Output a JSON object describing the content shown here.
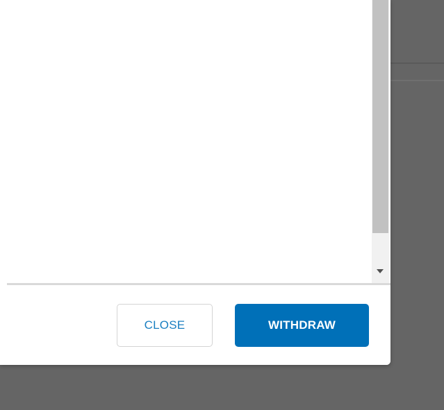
{
  "dialog": {
    "buttons": {
      "close_label": "CLOSE",
      "withdraw_label": "WITHDRAW"
    },
    "scrollbar": {
      "arrow_icon": "caret-down-icon"
    }
  },
  "colors": {
    "primary": "#0070b8",
    "secondary_text": "#1a7fc1",
    "overlay": "#656565",
    "scroll_thumb": "#c1c1c1"
  }
}
